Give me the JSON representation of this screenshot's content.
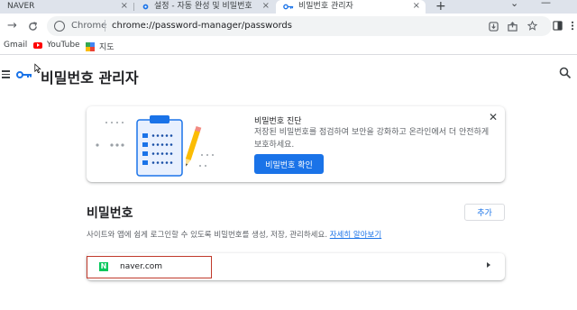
{
  "tabs": [
    {
      "label": "NAVER",
      "close": "×"
    },
    {
      "label": "설정 - 자동 완성 및 비밀번호",
      "close": "×"
    },
    {
      "label": "비밀번호 관리자",
      "close": "×"
    }
  ],
  "new_tab": "+",
  "window_controls": {
    "chevron": "⌄",
    "minimize": "—"
  },
  "nav": {
    "back": "→",
    "reload": "C"
  },
  "omnibox": {
    "scheme": "Chrome",
    "url": "chrome://password-manager/passwords"
  },
  "bookmarks": [
    {
      "label": "Gmail"
    },
    {
      "label": "YouTube"
    },
    {
      "label": "지도"
    }
  ],
  "page": {
    "title": "비밀번호 관리자"
  },
  "checkup": {
    "title": "비밀번호 진단",
    "description": "저장된 비밀번호를 점검하여 보안을 강화하고 온라인에서 더 안전하게 보호하세요.",
    "button": "비밀번호 확인",
    "close": "✕"
  },
  "passwords": {
    "title": "비밀번호",
    "add_button": "추가",
    "description": "사이트와 앱에 쉽게 로그인할 수 있도록 비밀번호를 생성, 저장, 관리하세요.",
    "learn_more": "자세히 알아보기",
    "items": [
      {
        "site": "naver.com",
        "icon_letter": "N"
      }
    ]
  },
  "colors": {
    "accent": "#1a73e8",
    "naver_green": "#03c75a",
    "highlight_border": "#c0392b",
    "tabstrip_bg": "#dee3eb"
  },
  "icons": [
    "key-icon",
    "search-icon",
    "hamburger-menu-icon",
    "chrome-icon",
    "download-icon",
    "share-icon",
    "star-icon",
    "sidebar-icon",
    "more-icon"
  ]
}
